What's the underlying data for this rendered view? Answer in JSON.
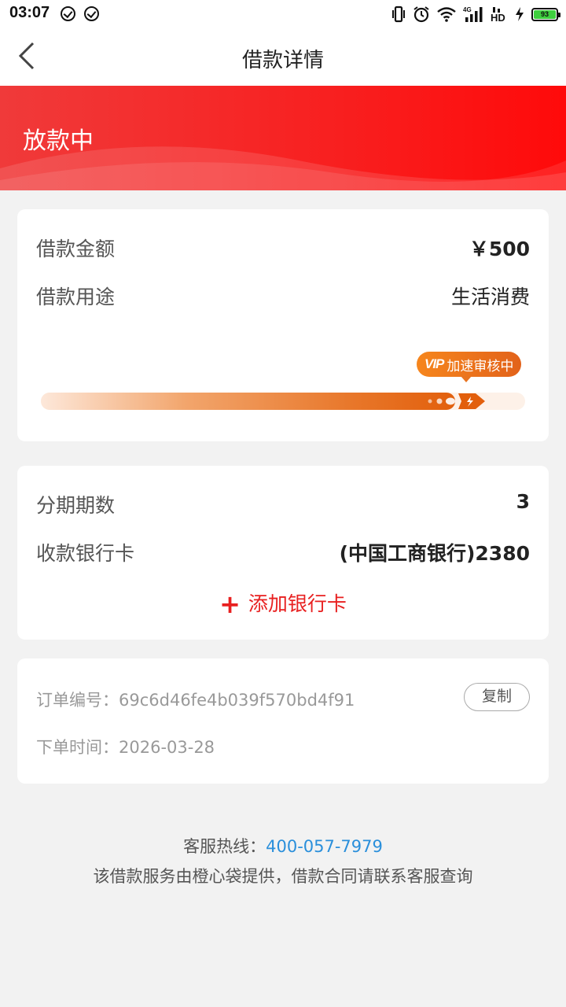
{
  "status_bar": {
    "time": "03:07",
    "battery": "93"
  },
  "header": {
    "title": "借款详情"
  },
  "banner": {
    "status": "放款中"
  },
  "loan": {
    "amount_label": "借款金额",
    "amount_value": "￥500",
    "purpose_label": "借款用途",
    "purpose_value": "生活消费",
    "vip_tag": "VIP",
    "vip_text": "加速审核中",
    "progress_fraction": 0.92
  },
  "installment": {
    "periods_label": "分期期数",
    "periods_value": "3",
    "card_label": "收款银行卡",
    "card_value": "(中国工商银行)2380",
    "add_card_label": "添加银行卡"
  },
  "order": {
    "number_label": "订单编号：",
    "number_value": "69c6d46fe4b039f570bd4f91",
    "copy_label": "复制",
    "time_label": "下单时间：",
    "time_value": "2026-03-28"
  },
  "footer": {
    "hotline_label": "客服热线：",
    "hotline_number": "400-057-7979",
    "disclaimer": "该借款服务由橙心袋提供，借款合同请联系客服查询"
  },
  "colors": {
    "brand_red": "#f81f1f",
    "accent_orange": "#e8772a",
    "link_blue": "#2a8fdb"
  }
}
